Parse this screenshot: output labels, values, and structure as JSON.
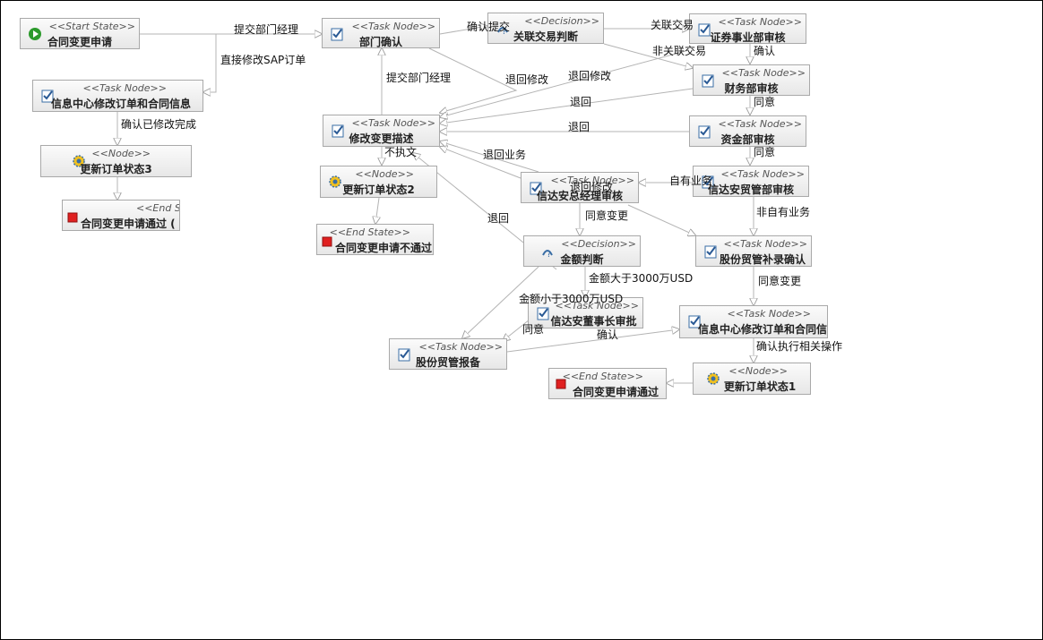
{
  "nodes": [
    {
      "id": "n_start",
      "stereo": "<<Start State>>",
      "name": "合同变更申请",
      "icon": "start-icon"
    },
    {
      "id": "n_dept",
      "stereo": "<<Task Node>>",
      "name": "部门确认",
      "icon": "task-icon"
    },
    {
      "id": "n_rel",
      "stereo": "<<Decision>>",
      "name": "关联交易判断",
      "icon": "decision-icon"
    },
    {
      "id": "n_sec",
      "stereo": "<<Task Node>>",
      "name": "证券事业部审核",
      "icon": "task-icon"
    },
    {
      "id": "n_info1",
      "stereo": "<<Task Node>>",
      "name": "信息中心修改订单和合同信息",
      "icon": "task-icon"
    },
    {
      "id": "n_fin",
      "stereo": "<<Task Node>>",
      "name": "财务部审核",
      "icon": "task-icon"
    },
    {
      "id": "n_mod",
      "stereo": "<<Task Node>>",
      "name": "修改变更描述",
      "icon": "task-icon"
    },
    {
      "id": "n_cap",
      "stereo": "<<Task Node>>",
      "name": "资金部审核",
      "icon": "task-icon"
    },
    {
      "id": "n_upd3",
      "stereo": "<<Node>>",
      "name": "更新订单状态3",
      "icon": "gear-icon"
    },
    {
      "id": "n_upd2",
      "stereo": "<<Node>>",
      "name": "更新订单状态2",
      "icon": "gear-icon"
    },
    {
      "id": "n_gm",
      "stereo": "<<Task Node>>",
      "name": "信达安总经理审核",
      "icon": "task-icon"
    },
    {
      "id": "n_trade",
      "stereo": "<<Task Node>>",
      "name": "信达安贸管部审核",
      "icon": "task-icon"
    },
    {
      "id": "n_end3",
      "stereo": "<<End State>>",
      "name": "合同变更申请通过 (",
      "icon": "end-icon"
    },
    {
      "id": "n_end2",
      "stereo": "<<End State>>",
      "name": "合同变更申请不通过",
      "icon": "end-icon"
    },
    {
      "id": "n_amt",
      "stereo": "<<Decision>>",
      "name": "金额判断",
      "icon": "decision-icon"
    },
    {
      "id": "n_stk",
      "stereo": "<<Task Node>>",
      "name": "股份贸管补录确认",
      "icon": "task-icon"
    },
    {
      "id": "n_chair",
      "stereo": "<<Task Node>>",
      "name": "信达安董事长审批",
      "icon": "task-icon"
    },
    {
      "id": "n_info2",
      "stereo": "<<Task Node>>",
      "name": "信息中心修改订单和合同信息",
      "icon": "task-icon"
    },
    {
      "id": "n_rep",
      "stereo": "<<Task Node>>",
      "name": "股份贸管报备",
      "icon": "task-icon"
    },
    {
      "id": "n_upd1",
      "stereo": "<<Node>>",
      "name": "更新订单状态1",
      "icon": "gear-icon"
    },
    {
      "id": "n_end1",
      "stereo": "<<End State>>",
      "name": "合同变更申请通过",
      "icon": "end-icon"
    }
  ],
  "edge_labels": [
    {
      "id": "l1",
      "text": "提交部门经理"
    },
    {
      "id": "l2",
      "text": "直接修改SAP订单"
    },
    {
      "id": "l3",
      "text": "确认提交"
    },
    {
      "id": "l4",
      "text": "关联交易"
    },
    {
      "id": "l5",
      "text": "非关联交易"
    },
    {
      "id": "l6",
      "text": "确认"
    },
    {
      "id": "l7",
      "text": "提交部门经理"
    },
    {
      "id": "l8",
      "text": "退回修改"
    },
    {
      "id": "l9",
      "text": "退回修改"
    },
    {
      "id": "l10",
      "text": "退回"
    },
    {
      "id": "l11",
      "text": "同意"
    },
    {
      "id": "l12",
      "text": "退回"
    },
    {
      "id": "l13",
      "text": "同意"
    },
    {
      "id": "l14",
      "text": "确认已修改完成"
    },
    {
      "id": "l15",
      "text": "不执文"
    },
    {
      "id": "l16",
      "text": "退回业务"
    },
    {
      "id": "l17",
      "text": "退回修改"
    },
    {
      "id": "l18",
      "text": "自有业务"
    },
    {
      "id": "l19",
      "text": "同意变更"
    },
    {
      "id": "l20",
      "text": "非自有业务"
    },
    {
      "id": "l21",
      "text": "退回"
    },
    {
      "id": "l22",
      "text": "金额大于3000万USD"
    },
    {
      "id": "l23",
      "text": "金额小于3000万USD"
    },
    {
      "id": "l24",
      "text": "同意变更"
    },
    {
      "id": "l25",
      "text": "同意"
    },
    {
      "id": "l26",
      "text": "确认"
    },
    {
      "id": "l27",
      "text": "确认执行相关操作"
    }
  ]
}
